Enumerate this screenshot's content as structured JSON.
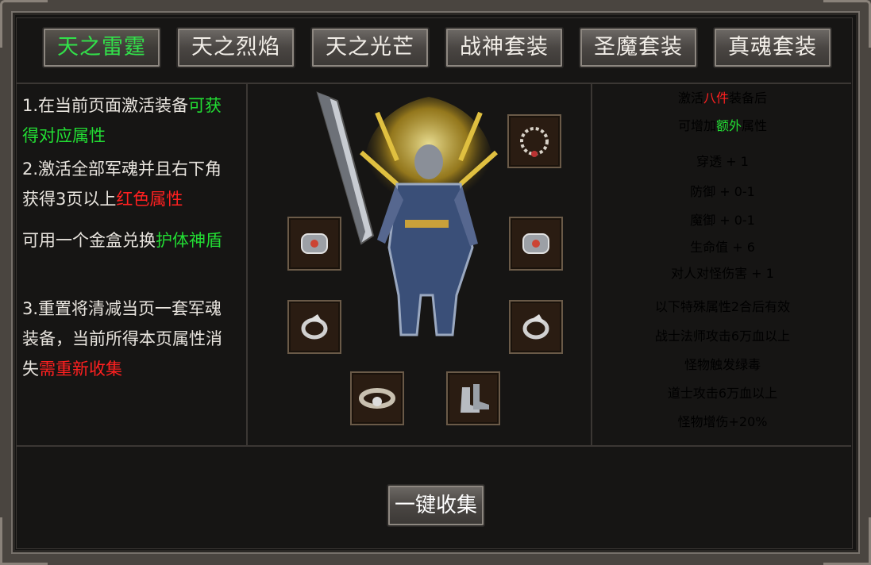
{
  "tabs": [
    "天之雷霆",
    "天之烈焰",
    "天之光芒",
    "战神套装",
    "圣魔套装",
    "真魂套装"
  ],
  "active_tab": 0,
  "instructions": {
    "item1_prefix": "1.在当前页面激活装备",
    "item1_highlight": "可获得对应属性",
    "item2_prefix": "2.激活全部军魂并且右下角获得3页以上",
    "item2_highlight": "红色属性",
    "exchange_prefix": "可用一个金盒兑换",
    "exchange_highlight": "护体神盾",
    "item3_prefix": "3.重置将清减当页一套军魂装备，当前所得本页属性消失",
    "item3_highlight": "需重新收集"
  },
  "bonus": {
    "line1_prefix": "激活",
    "line1_highlight": "八件",
    "line1_suffix": "装备后",
    "line2_prefix": "可增加",
    "line2_highlight": "额外",
    "line2_suffix": "属性",
    "stats": [
      "穿透 + 1",
      "防御 + 0-1",
      "魔御 + 0-1",
      "生命值 + 6",
      "对人对怪伤害 + 1"
    ],
    "special": [
      "以下特殊属性2合后有效",
      "战士法师攻击6万血以上",
      "怪物触发绿毒",
      "道士攻击6万血以上",
      "怪物增伤+20%"
    ]
  },
  "slots": [
    "necklace",
    "left-bracelet",
    "right-bracelet",
    "left-ring",
    "right-ring",
    "belt",
    "boots"
  ],
  "collect_button": "一键收集",
  "colors": {
    "green": "#22dd33",
    "red": "#ff2020",
    "text": "#e8e4de",
    "stat": "#b8b2aa"
  }
}
